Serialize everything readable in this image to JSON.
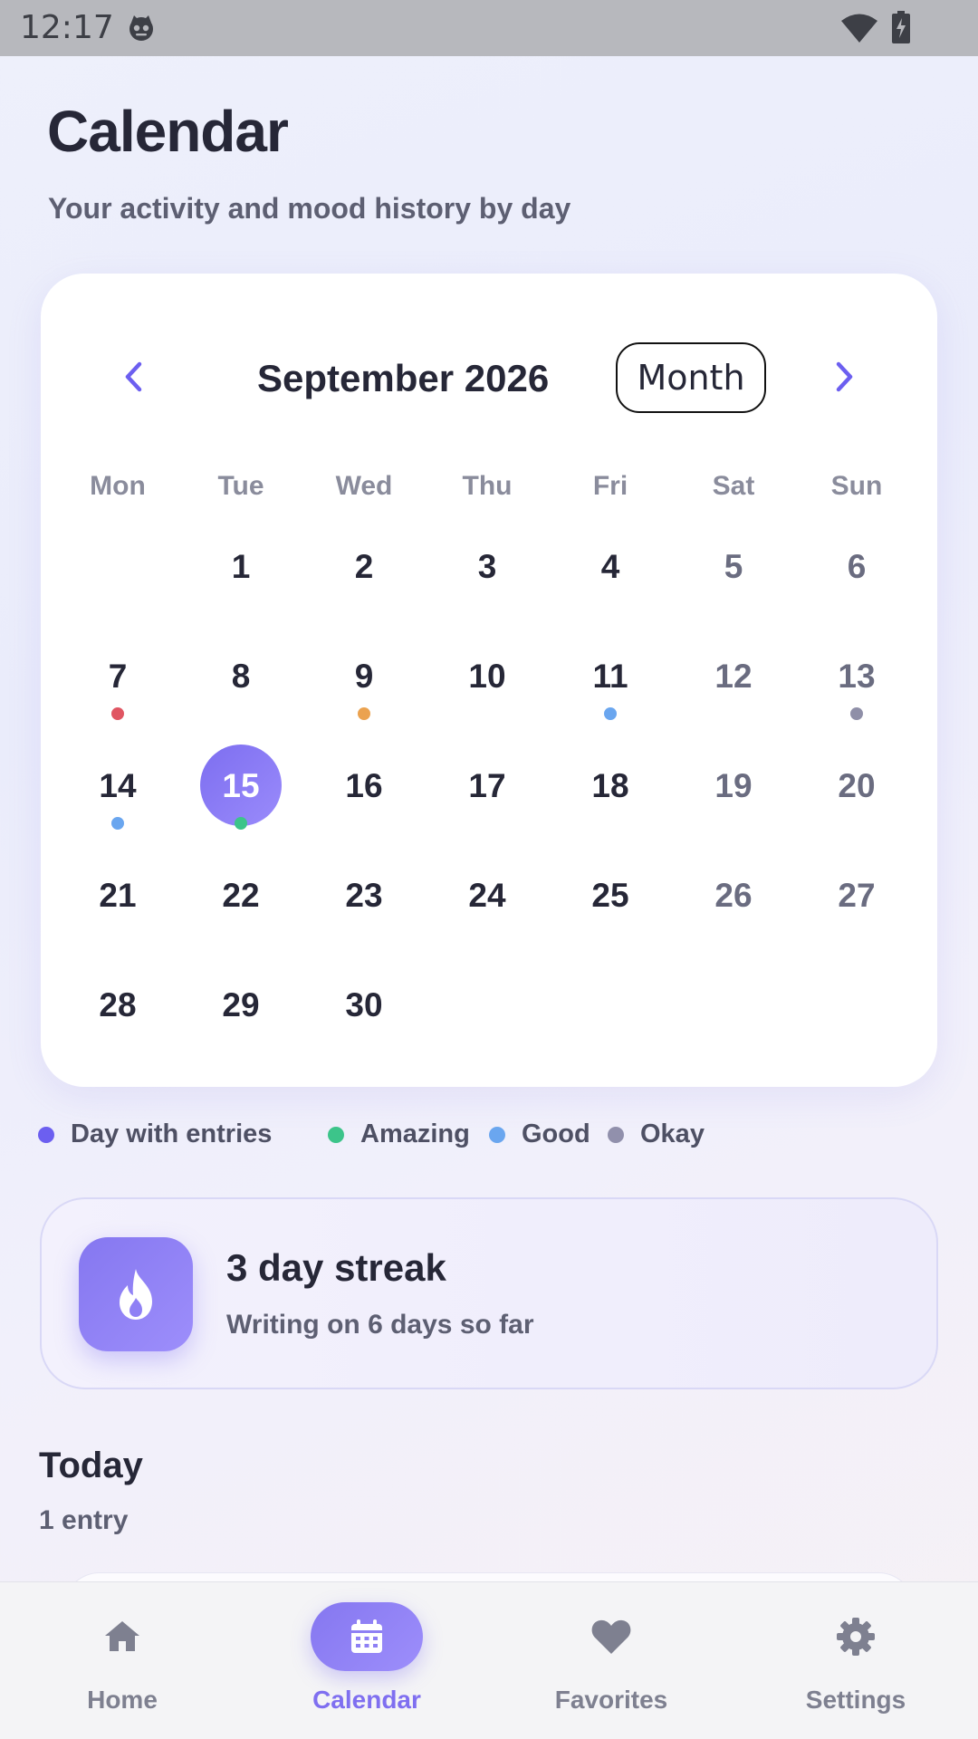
{
  "status_bar": {
    "time": "12:17",
    "icons": [
      "cat-notification-icon",
      "wifi-icon",
      "battery-charging-icon"
    ]
  },
  "header": {
    "title": "Calendar",
    "subtitle": "Your activity and mood history by day"
  },
  "calendar": {
    "month_label": "September 2026",
    "view_toggle": "Month",
    "weekdays": [
      "Mon",
      "Tue",
      "Wed",
      "Thu",
      "Fri",
      "Sat",
      "Sun"
    ],
    "first_weekday_index": 1,
    "days_in_month": 30,
    "selected_day": 15,
    "accent_color": "#8577f0",
    "mood_dots": [
      {
        "day": 7,
        "color": "#e05562"
      },
      {
        "day": 9,
        "color": "#eba24f"
      },
      {
        "day": 11,
        "color": "#6aa6ef"
      },
      {
        "day": 13,
        "color": "#8f8fa8"
      },
      {
        "day": 14,
        "color": "#6aa6ef"
      },
      {
        "day": 15,
        "color": "#3cc48a"
      }
    ]
  },
  "legend": [
    {
      "label": "Day with entries",
      "color": "#6c5ff0"
    },
    {
      "label": "Amazing",
      "color": "#3cc48a"
    },
    {
      "label": "Good",
      "color": "#6aa6ef"
    },
    {
      "label": "Okay",
      "color": "#9190ac"
    }
  ],
  "streak": {
    "title": "3 day streak",
    "subtitle": "Writing on 6 days so far",
    "icon": "flame-icon"
  },
  "today": {
    "title": "Today",
    "count": "1 entry"
  },
  "bottom_nav": {
    "active": "Calendar",
    "items": [
      {
        "label": "Home",
        "icon": "home-icon"
      },
      {
        "label": "Calendar",
        "icon": "calendar-icon"
      },
      {
        "label": "Favorites",
        "icon": "heart-icon"
      },
      {
        "label": "Settings",
        "icon": "gear-icon"
      }
    ]
  }
}
